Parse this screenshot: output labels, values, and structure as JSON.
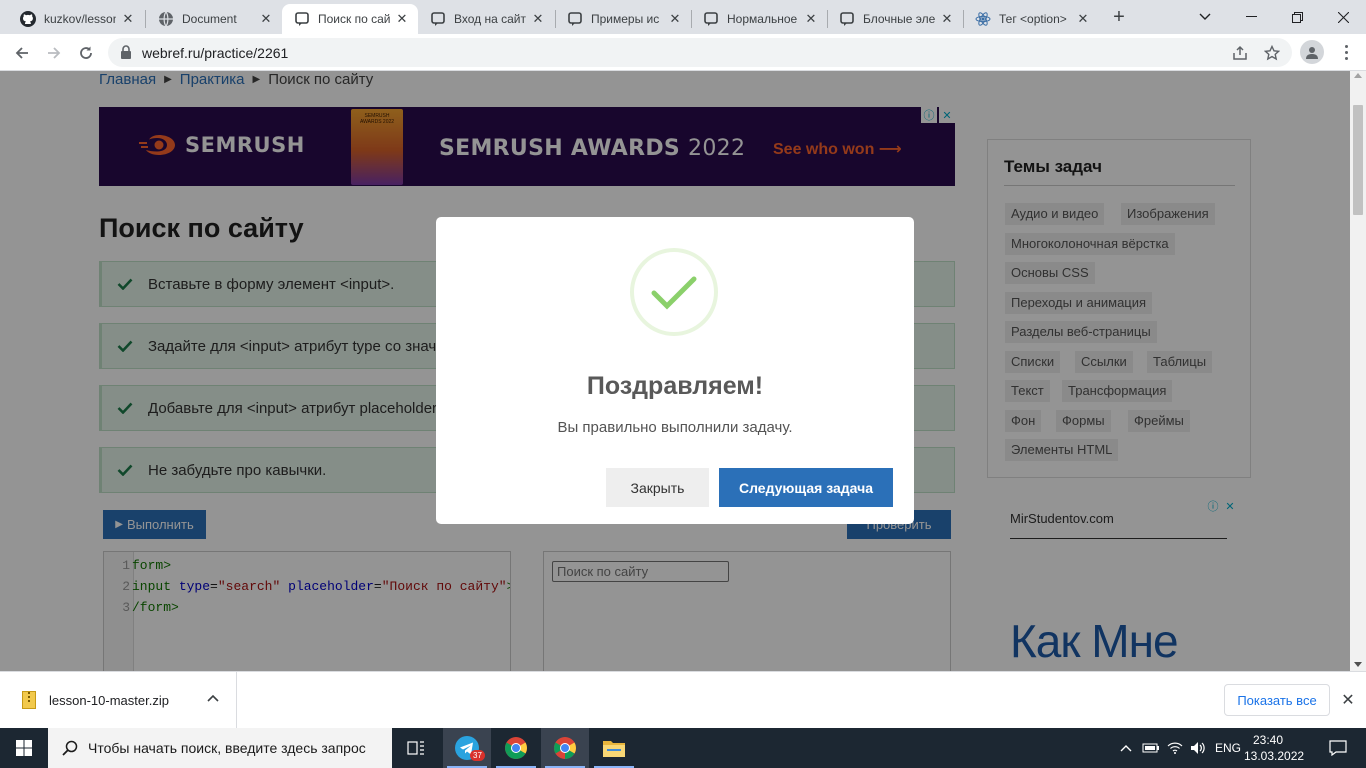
{
  "browser": {
    "tabs": [
      {
        "label": "kuzkov/lesson",
        "icon": "github-icon"
      },
      {
        "label": "Document",
        "icon": "globe-icon"
      },
      {
        "label": "Поиск по сайт",
        "icon": "webref-icon",
        "active": true
      },
      {
        "label": "Вход на сайт",
        "icon": "webref-icon"
      },
      {
        "label": "Примеры ис",
        "icon": "webref-icon"
      },
      {
        "label": "Нормальное",
        "icon": "webref-icon"
      },
      {
        "label": "Блочные эле",
        "icon": "webref-icon"
      },
      {
        "label": "Тег <option>",
        "icon": "react-icon"
      }
    ],
    "url": "webref.ru/practice/2261"
  },
  "page": {
    "breadcrumbs": [
      "Главная",
      "Практика",
      "Поиск по сайту"
    ],
    "ad_banner": {
      "brand": "SEMRUSH",
      "trophy_text": "SEMRUSH AWARDS 2022",
      "headline_bold": "SEMRUSH AWARDS",
      "headline_year": "2022",
      "cta": "See who won ⟶",
      "info_icon": "ⓘ",
      "close_icon": "✕"
    },
    "title": "Поиск по сайту",
    "tasks": [
      "Вставьте в форму элемент <input>.",
      "Задайте для <input> атрибут type со значе",
      "Добавьте для <input> атрибут placeholder",
      "Не забудьте про кавычки."
    ],
    "run_label": "Выполнить",
    "check_label": "Проверить",
    "code_lines": [
      {
        "num": "1",
        "parts": [
          {
            "t": "tg",
            "v": "form>"
          }
        ]
      },
      {
        "num": "2",
        "parts": [
          {
            "t": "tg",
            "v": "input"
          },
          {
            "t": "pl",
            "v": " "
          },
          {
            "t": "at",
            "v": "type"
          },
          {
            "t": "pl",
            "v": "="
          },
          {
            "t": "st",
            "v": "\"search\""
          },
          {
            "t": "pl",
            "v": " "
          },
          {
            "t": "at",
            "v": "placeholder"
          },
          {
            "t": "pl",
            "v": "="
          },
          {
            "t": "st",
            "v": "\"Поиск по сайту\""
          },
          {
            "t": "tg",
            "v": ">"
          }
        ]
      },
      {
        "num": "3",
        "parts": [
          {
            "t": "tg",
            "v": "/form>"
          }
        ]
      }
    ],
    "preview_placeholder": "Поиск по сайту"
  },
  "sidebar": {
    "title": "Темы задач",
    "topics": [
      "Аудио и видео",
      "Изображения",
      "Многоколоночная вёрстка",
      "Основы CSS",
      "Переходы и анимация",
      "Разделы веб-страницы",
      "Списки",
      "Ссылки",
      "Таблицы",
      "Текст",
      "Трансформация",
      "Фон",
      "Формы",
      "Фреймы",
      "Элементы HTML"
    ],
    "ad": {
      "site": "MirStudentov.com",
      "headline": "Как Мне"
    }
  },
  "modal": {
    "title": "Поздравляем!",
    "text": "Вы правильно выполнили задачу.",
    "close_label": "Закрыть",
    "next_label": "Следующая задача"
  },
  "downloads": {
    "file": "lesson-10-master.zip",
    "show_all": "Показать все"
  },
  "taskbar": {
    "search_placeholder": "Чтобы начать поиск, введите здесь запрос",
    "telegram_badge": "37",
    "lang": "ENG",
    "time": "23:40",
    "date": "13.03.2022"
  },
  "colors": {
    "accent": "#2b70b8",
    "task_bg": "#e6f4ea",
    "success": "#8bd06b",
    "banner_bg": "#2a0b4f",
    "semrush_orange": "#ff642d"
  }
}
